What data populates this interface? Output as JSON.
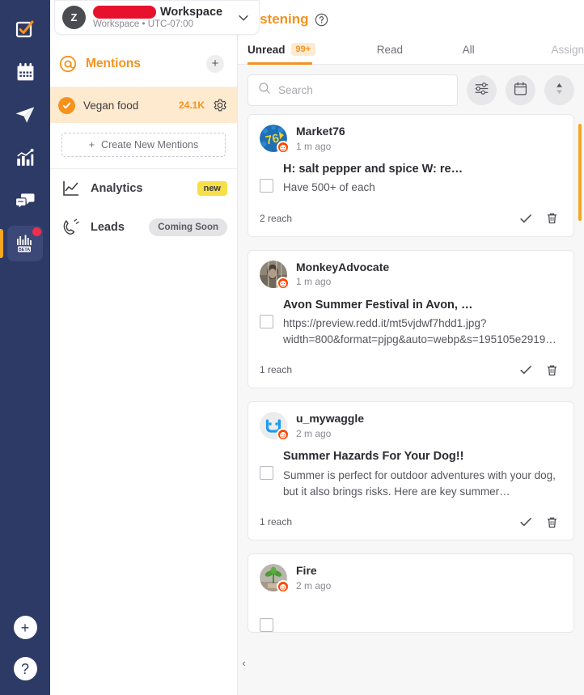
{
  "workspace": {
    "avatar_initial": "Z",
    "name_suffix": "Workspace",
    "subtitle": "Workspace • UTC-07:00",
    "redacted": true
  },
  "rail": {
    "items": [
      {
        "name": "tasks",
        "icon": "checkbox-icon",
        "active": false
      },
      {
        "name": "calendar",
        "icon": "calendar-icon",
        "active": false
      },
      {
        "name": "publish",
        "icon": "paper-plane-icon",
        "active": false
      },
      {
        "name": "analytics",
        "icon": "bar-chart-icon",
        "active": false
      },
      {
        "name": "engage",
        "icon": "chat-bubbles-icon",
        "active": false
      },
      {
        "name": "listening",
        "icon": "listening-beta-icon",
        "active": true,
        "badge": "BETA"
      }
    ],
    "bottom": [
      {
        "name": "add",
        "label": "+"
      },
      {
        "name": "help",
        "label": "?"
      }
    ]
  },
  "sidebar": {
    "mentions_label": "Mentions",
    "add_mention_label": "+",
    "mention_items": [
      {
        "label": "Vegan food",
        "count": "24.1K",
        "selected": true
      }
    ],
    "create_label": "Create New Mentions",
    "create_plus": "+",
    "nav": [
      {
        "label": "Analytics",
        "badge": "new",
        "badge_type": "new",
        "icon": "line-chart-icon"
      },
      {
        "label": "Leads",
        "badge": "Coming Soon",
        "badge_type": "soon",
        "icon": "magnet-icon"
      }
    ]
  },
  "main": {
    "title": "Listening",
    "tabs": [
      {
        "label": "Unread",
        "badge": "99+",
        "active": true
      },
      {
        "label": "Read",
        "badge": "",
        "active": false
      },
      {
        "label": "All",
        "badge": "",
        "active": false
      },
      {
        "label": "Assign",
        "badge": "",
        "active": false,
        "disabled": true
      }
    ],
    "search": {
      "placeholder": "Search",
      "value": ""
    },
    "toolbar": [
      {
        "name": "filter-button",
        "icon": "sliders-icon"
      },
      {
        "name": "date-button",
        "icon": "calendar-icon"
      },
      {
        "name": "sort-button",
        "icon": "sort-arrows-icon"
      }
    ],
    "collapse_label": "‹"
  },
  "cards": [
    {
      "author": "Market76",
      "time": "1 m ago",
      "title": "H: salt pepper and spice W: re…",
      "snippet": "Have 500+ of each",
      "reach": "2 reach",
      "source": "reddit",
      "avatar_kind": "market76"
    },
    {
      "author": "MonkeyAdvocate",
      "time": "1 m ago",
      "title": "Avon Summer Festival in Avon, …",
      "snippet": "https://preview.redd.it/mt5vjdwf7hdd1.jpg?width=800&format=pjpg&auto=webp&s=195105e2919…",
      "reach": "1 reach",
      "source": "reddit",
      "avatar_kind": "photo"
    },
    {
      "author": "u_mywaggle",
      "time": "2 m ago",
      "title": "Summer Hazards For Your Dog!!",
      "snippet": "Summer is perfect for outdoor adventures with your dog, but it also brings risks. Here are key summer…",
      "reach": "1 reach",
      "source": "reddit",
      "avatar_kind": "mywaggle"
    },
    {
      "author": "Fire",
      "time": "2 m ago",
      "title": "",
      "snippet": "",
      "reach": "",
      "source": "reddit",
      "avatar_kind": "plant"
    }
  ],
  "colors": {
    "accent": "#f5921e",
    "rail_bg": "#2e3a66",
    "reddit": "#ff4500",
    "badge_new": "#f7df4a",
    "redaction": "#e8112d"
  }
}
